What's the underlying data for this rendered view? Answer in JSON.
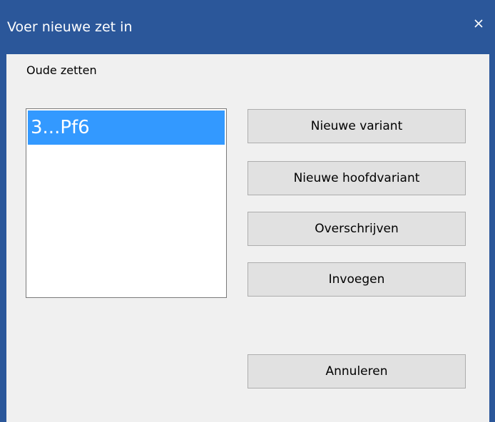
{
  "window": {
    "title": "Voer nieuwe zet in",
    "close_icon": "close-icon",
    "accent_color": "#2b579a"
  },
  "moves_label": "Oude zetten",
  "moves_list": {
    "items": [
      {
        "label": "3...Pf6",
        "selected": true
      }
    ],
    "selection_color": "#3399ff"
  },
  "buttons": {
    "new_variation": "Nieuwe variant",
    "new_main_line": "Nieuwe hoofdvariant",
    "overwrite": "Overschrijven",
    "insert": "Invoegen",
    "cancel": "Annuleren"
  }
}
